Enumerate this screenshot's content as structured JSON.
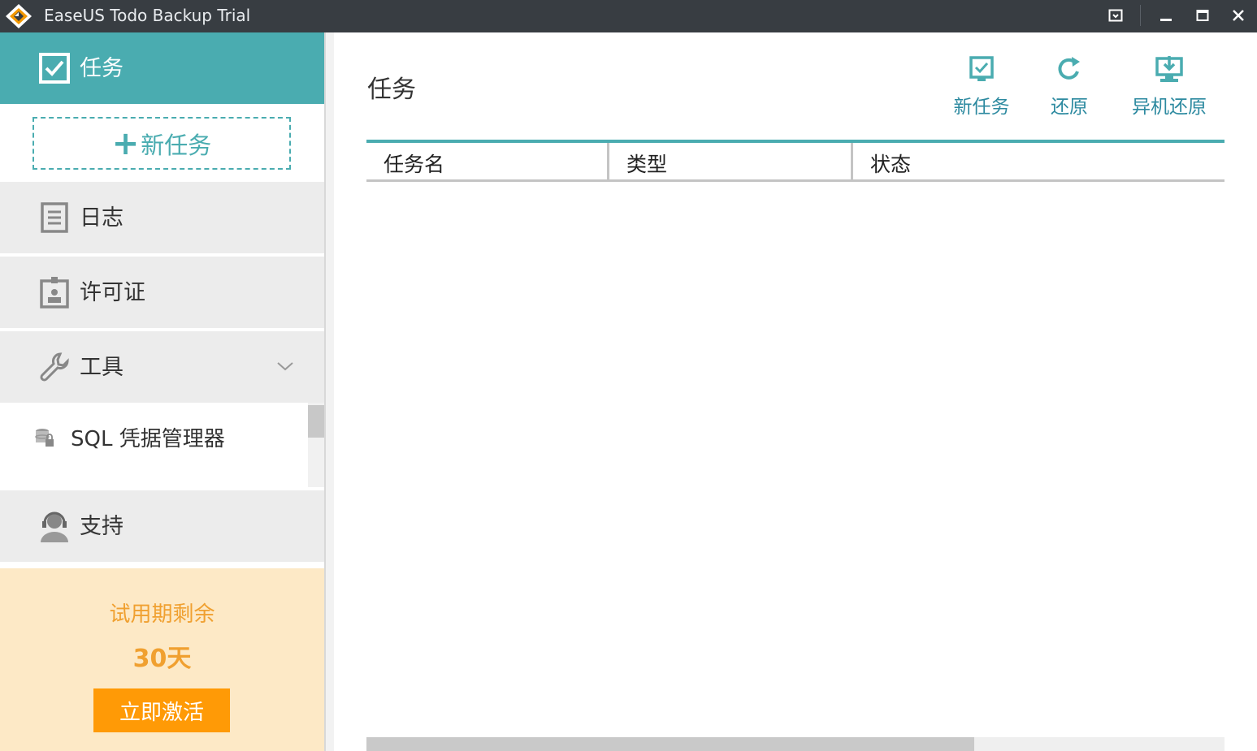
{
  "window": {
    "title": "EaseUS Todo Backup Trial",
    "icons": [
      "easeus-logo",
      "restore-down-icon",
      "minimize-icon",
      "maximize-icon",
      "close-icon"
    ]
  },
  "sidebar": {
    "items": [
      {
        "label": "任务",
        "icon": "task-check-icon",
        "active": true
      },
      {
        "label": "日志",
        "icon": "log-document-icon"
      },
      {
        "label": "许可证",
        "icon": "license-badge-icon"
      },
      {
        "label": "工具",
        "icon": "wrench-icon"
      },
      {
        "label": "SQL 凭据管理器",
        "icon": "database-lock-icon"
      },
      {
        "label": "支持",
        "icon": "support-headset-icon"
      }
    ],
    "new_task_label": "新任务",
    "trial": {
      "label": "试用期剩余",
      "days": "30天",
      "activate_label": "立即激活"
    },
    "accent": "#4aacb0"
  },
  "main": {
    "title": "任务",
    "toolbar": [
      {
        "label": "新任务",
        "icon": "new-task-icon"
      },
      {
        "label": "还原",
        "icon": "restore-icon"
      },
      {
        "label": "异机还原",
        "icon": "remote-restore-icon"
      }
    ],
    "table": {
      "columns": [
        "任务名",
        "类型",
        "状态"
      ],
      "rows": []
    }
  }
}
